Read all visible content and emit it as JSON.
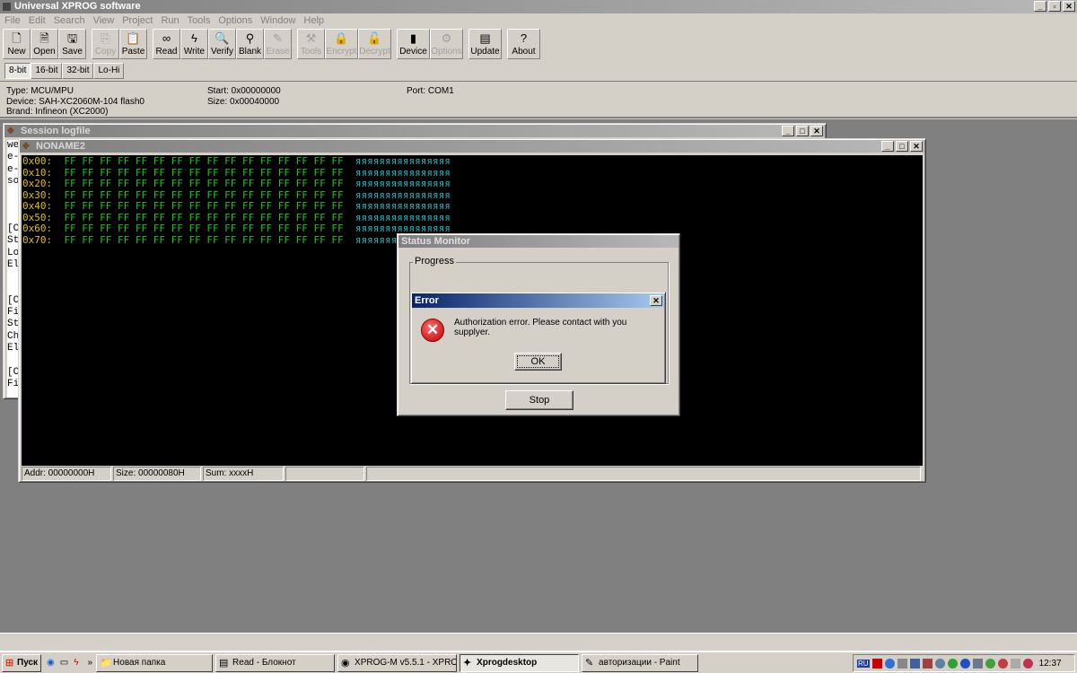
{
  "app": {
    "title": "Universal XPROG software"
  },
  "menu": [
    "File",
    "Edit",
    "Search",
    "View",
    "Project",
    "Run",
    "Tools",
    "Options",
    "Window",
    "Help"
  ],
  "toolbar": [
    {
      "label": "New",
      "icon": "new-file-icon",
      "enabled": true
    },
    {
      "label": "Open",
      "icon": "open-file-icon",
      "enabled": true
    },
    {
      "label": "Save",
      "icon": "save-icon",
      "enabled": true
    },
    {
      "label": "Copy",
      "icon": "copy-icon",
      "enabled": false
    },
    {
      "label": "Paste",
      "icon": "paste-icon",
      "enabled": true
    },
    {
      "label": "Read",
      "icon": "read-icon",
      "enabled": true
    },
    {
      "label": "Write",
      "icon": "write-icon",
      "enabled": true
    },
    {
      "label": "Verify",
      "icon": "verify-icon",
      "enabled": true
    },
    {
      "label": "Blank",
      "icon": "blank-icon",
      "enabled": true
    },
    {
      "label": "Erase",
      "icon": "erase-icon",
      "enabled": false
    },
    {
      "label": "Tools",
      "icon": "tools-icon",
      "enabled": false
    },
    {
      "label": "Encrypt",
      "icon": "encrypt-icon",
      "enabled": false
    },
    {
      "label": "Decrypt",
      "icon": "decrypt-icon",
      "enabled": false
    },
    {
      "label": "Device",
      "icon": "device-icon",
      "enabled": true
    },
    {
      "label": "Options",
      "icon": "options-icon",
      "enabled": false
    },
    {
      "label": "Update",
      "icon": "update-icon",
      "enabled": true
    },
    {
      "label": "About",
      "icon": "about-icon",
      "enabled": true
    }
  ],
  "tabs": [
    "8-bit",
    "16-bit",
    "32-bit",
    "Lo-Hi"
  ],
  "info": {
    "type": "Type: MCU/MPU",
    "device": "Device: SAH-XC2060M-104 flash0",
    "brand": "Brand: Infineon (XC2000)",
    "start": "Start: 0x00000000",
    "size": "Size: 0x00040000",
    "port": "Port: COM1"
  },
  "session": {
    "title": "Session logfile",
    "lines": "we\ne-\ne-\nso\n\n\n\n[C\nSt\nLo\nEl\n\n\n[C\nFi\nSt\nCh\nEl\n\n[C\nFi"
  },
  "editor": {
    "title": "NONAME2",
    "rows": [
      {
        "addr": "0x00:",
        "bytes": "FF FF FF FF FF FF FF FF FF FF FF FF FF FF FF FF",
        "ascii": "яяяяяяяяяяяяяяяя"
      },
      {
        "addr": "0x10:",
        "bytes": "FF FF FF FF FF FF FF FF FF FF FF FF FF FF FF FF",
        "ascii": "яяяяяяяяяяяяяяяя"
      },
      {
        "addr": "0x20:",
        "bytes": "FF FF FF FF FF FF FF FF FF FF FF FF FF FF FF FF",
        "ascii": "яяяяяяяяяяяяяяяя"
      },
      {
        "addr": "0x30:",
        "bytes": "FF FF FF FF FF FF FF FF FF FF FF FF FF FF FF FF",
        "ascii": "яяяяяяяяяяяяяяяя"
      },
      {
        "addr": "0x40:",
        "bytes": "FF FF FF FF FF FF FF FF FF FF FF FF FF FF FF FF",
        "ascii": "яяяяяяяяяяяяяяяя"
      },
      {
        "addr": "0x50:",
        "bytes": "FF FF FF FF FF FF FF FF FF FF FF FF FF FF FF FF",
        "ascii": "яяяяяяяяяяяяяяяя"
      },
      {
        "addr": "0x60:",
        "bytes": "FF FF FF FF FF FF FF FF FF FF FF FF FF FF FF FF",
        "ascii": "яяяяяяяяяяяяяяяя"
      },
      {
        "addr": "0x70:",
        "bytes": "FF FF FF FF FF FF FF FF FF FF FF FF FF FF FF FF",
        "ascii": "яяяяяяяяяяяяяяяя"
      }
    ],
    "status": {
      "addr": "Addr: 00000000H",
      "size": "Size: 00000080H",
      "sum": "Sum: xxxxH"
    }
  },
  "status_monitor": {
    "title": "Status Monitor",
    "group": "Progress",
    "stop": "Stop"
  },
  "error": {
    "title": "Error",
    "message": "Authorization error. Please contact with you supplyer.",
    "ok": "OK",
    "close": "✕"
  },
  "taskbar": {
    "start": "Пуск",
    "chevron": "»",
    "items": [
      {
        "label": "Новая папка",
        "icon": "folder-icon",
        "active": false
      },
      {
        "label": "Read - Блокнот",
        "icon": "notepad-icon",
        "active": false
      },
      {
        "label": "XPROG-M v5.5.1 - XPRO...",
        "icon": "chrome-icon",
        "active": false
      },
      {
        "label": "Xprogdesktop",
        "icon": "xprog-icon",
        "active": true
      },
      {
        "label": "авторизации - Paint",
        "icon": "paint-icon",
        "active": false
      }
    ],
    "lang": "RU",
    "clock": "12:37"
  }
}
